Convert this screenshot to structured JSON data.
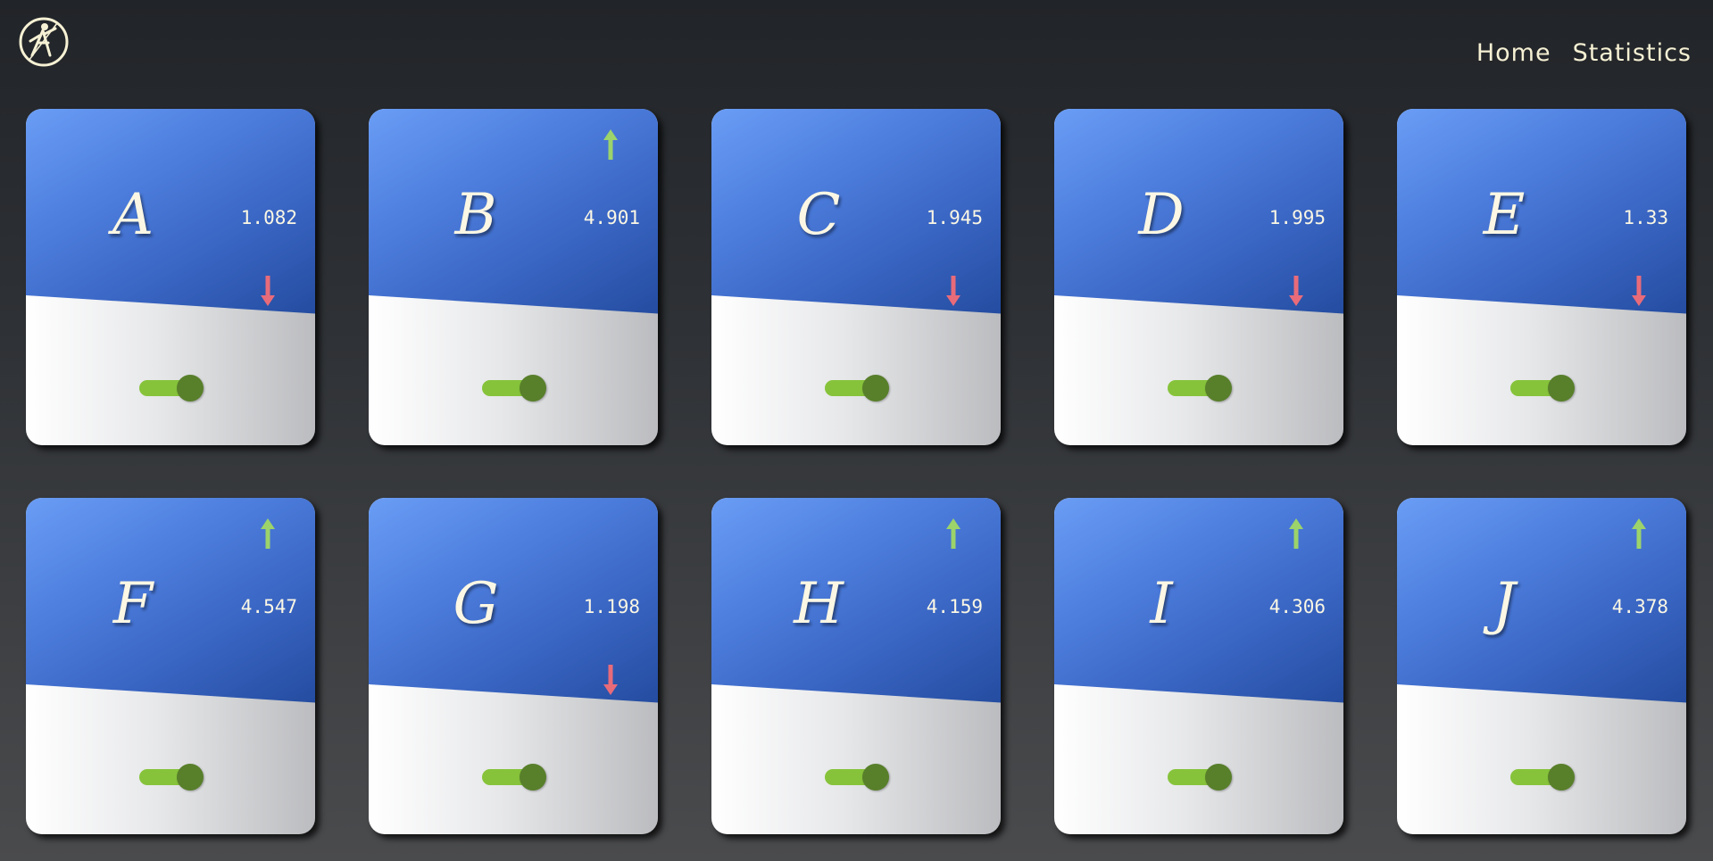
{
  "nav": {
    "home_label": "Home",
    "statistics_label": "Statistics"
  },
  "colors": {
    "card_blue": "#3a66c4",
    "up_arrow": "#9cd36b",
    "down_arrow": "#e86b7a",
    "toggle_track": "#86c33b",
    "toggle_knob": "#587f2a",
    "text_cream": "#fbf7e4"
  },
  "cards": [
    {
      "letter": "A",
      "value": "1.082",
      "trend": "down",
      "toggle_on": true
    },
    {
      "letter": "B",
      "value": "4.901",
      "trend": "up",
      "toggle_on": true
    },
    {
      "letter": "C",
      "value": "1.945",
      "trend": "down",
      "toggle_on": true
    },
    {
      "letter": "D",
      "value": "1.995",
      "trend": "down",
      "toggle_on": true
    },
    {
      "letter": "E",
      "value": "1.33",
      "trend": "down",
      "toggle_on": true
    },
    {
      "letter": "F",
      "value": "4.547",
      "trend": "up",
      "toggle_on": true
    },
    {
      "letter": "G",
      "value": "1.198",
      "trend": "down",
      "toggle_on": true
    },
    {
      "letter": "H",
      "value": "4.159",
      "trend": "up",
      "toggle_on": true
    },
    {
      "letter": "I",
      "value": "4.306",
      "trend": "up",
      "toggle_on": true
    },
    {
      "letter": "J",
      "value": "4.378",
      "trend": "up",
      "toggle_on": true
    }
  ]
}
